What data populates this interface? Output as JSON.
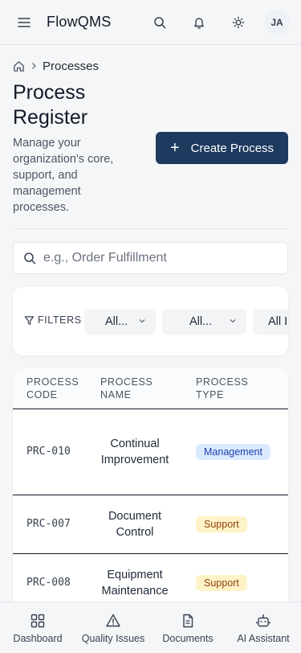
{
  "app": {
    "brand": "FlowQMS",
    "user_initials": "JA"
  },
  "breadcrumb": {
    "current": "Processes"
  },
  "header": {
    "title": "Process Register",
    "description": "Manage your organization's core, support, and management processes.",
    "create_button": "Create Process"
  },
  "search": {
    "placeholder": "e.g., Order Fulfillment",
    "value": ""
  },
  "filters": {
    "label": "FILTERS",
    "selects": [
      {
        "value": "All..."
      },
      {
        "value": "All..."
      },
      {
        "value": "All ISO"
      }
    ]
  },
  "table": {
    "columns": [
      "PROCESS CODE",
      "PROCESS NAME",
      "PROCESS TYPE"
    ],
    "rows": [
      {
        "code": "PRC-010",
        "name": "Continual Improvement",
        "type": "Management"
      },
      {
        "code": "PRC-007",
        "name": "Document Control",
        "type": "Support"
      },
      {
        "code": "PRC-008",
        "name": "Equipment Maintenance",
        "type": "Support"
      }
    ]
  },
  "bottom_nav": [
    {
      "label": "Dashboard",
      "icon": "dashboard-grid-icon"
    },
    {
      "label": "Quality Issues",
      "icon": "warning-triangle-icon"
    },
    {
      "label": "Documents",
      "icon": "document-icon"
    },
    {
      "label": "AI Assistant",
      "icon": "robot-icon"
    }
  ],
  "colors": {
    "primary": "#1e3a5f",
    "management_badge_bg": "#dbeafe",
    "management_badge_text": "#1e40af",
    "support_badge_bg": "#fef3c7",
    "support_badge_text": "#92400e"
  }
}
